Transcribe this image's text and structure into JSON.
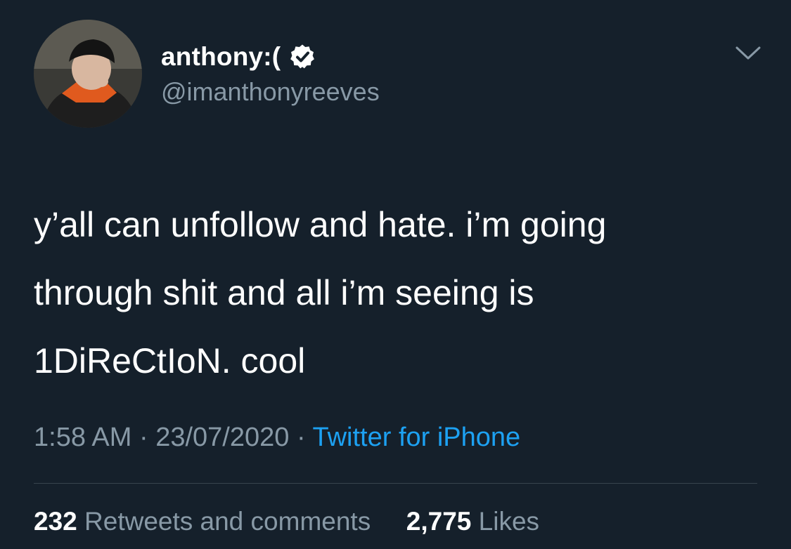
{
  "user": {
    "display_name": "anthony:(",
    "handle": "@imanthonyreeves",
    "verified": true
  },
  "tweet": {
    "lines": [
      "y’all can unfollow and hate. i’m going",
      "through shit and all i’m seeing is",
      "1DiReCtIoN. cool"
    ]
  },
  "meta": {
    "time": "1:58 AM",
    "separator": "·",
    "date": "23/07/2020",
    "source": "Twitter for iPhone"
  },
  "stats": {
    "retweets_count": "232",
    "retweets_label": "Retweets and comments",
    "likes_count": "2,775",
    "likes_label": "Likes"
  },
  "colors": {
    "background": "#15202b",
    "secondary_text": "#8899a6",
    "link": "#1da1f2",
    "divider": "#38444d"
  },
  "icons": {
    "verified": "verified-badge-icon",
    "menu": "chevron-down-icon"
  }
}
